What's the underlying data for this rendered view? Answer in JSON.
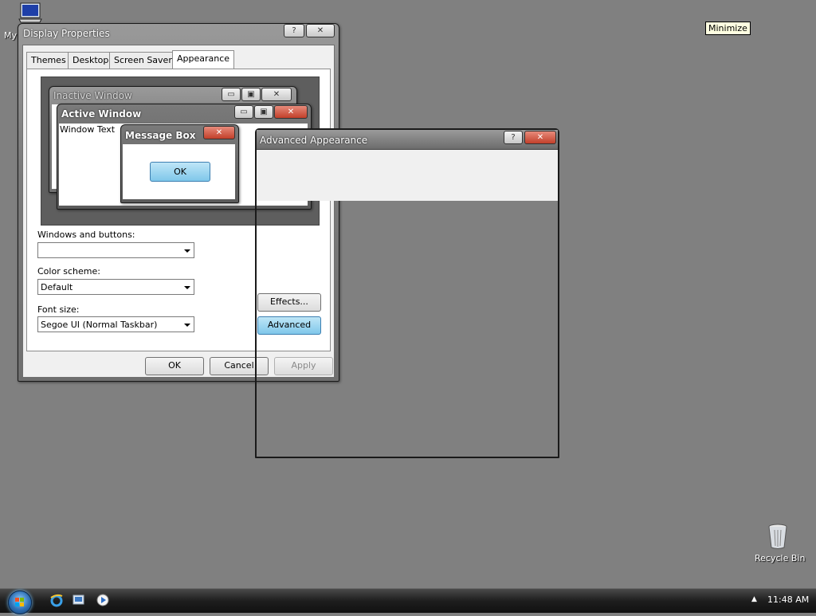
{
  "desktop": {
    "my_computer_label": "My",
    "recycle_bin_label": "Recycle Bin",
    "tooltip": "Minimize"
  },
  "display_properties": {
    "title": "Display Properties",
    "help_glyph": "?",
    "close_glyph": "✕",
    "tabs": [
      "Themes",
      "Desktop",
      "Screen Saver",
      "Appearance"
    ],
    "preview": {
      "inactive_window_title": "Inactive Window",
      "active_window_title": "Active Window",
      "window_text": "Window Text",
      "message_box_title": "Message Box",
      "message_box_ok": "OK"
    },
    "windows_and_buttons_label": "Windows and buttons:",
    "windows_and_buttons_value": "",
    "color_scheme_label": "Color scheme:",
    "color_scheme_value": "Default",
    "font_size_label": "Font size:",
    "font_size_value": "Segoe UI (Normal Taskbar)",
    "effects_label": "Effects...",
    "advanced_label": "Advanced",
    "ok_label": "OK",
    "cancel_label": "Cancel",
    "apply_label": "Apply"
  },
  "advanced_appearance": {
    "title": "Advanced Appearance",
    "help_glyph": "?",
    "close_glyph": "✕"
  },
  "taskbar": {
    "clock": "11:48 AM",
    "tray_arrow": "▲"
  },
  "colors": {
    "desktop": "#808080",
    "taskbar": "#1e1e1e",
    "focus_button": "#7fc7ea",
    "close_button": "#c2402a"
  }
}
